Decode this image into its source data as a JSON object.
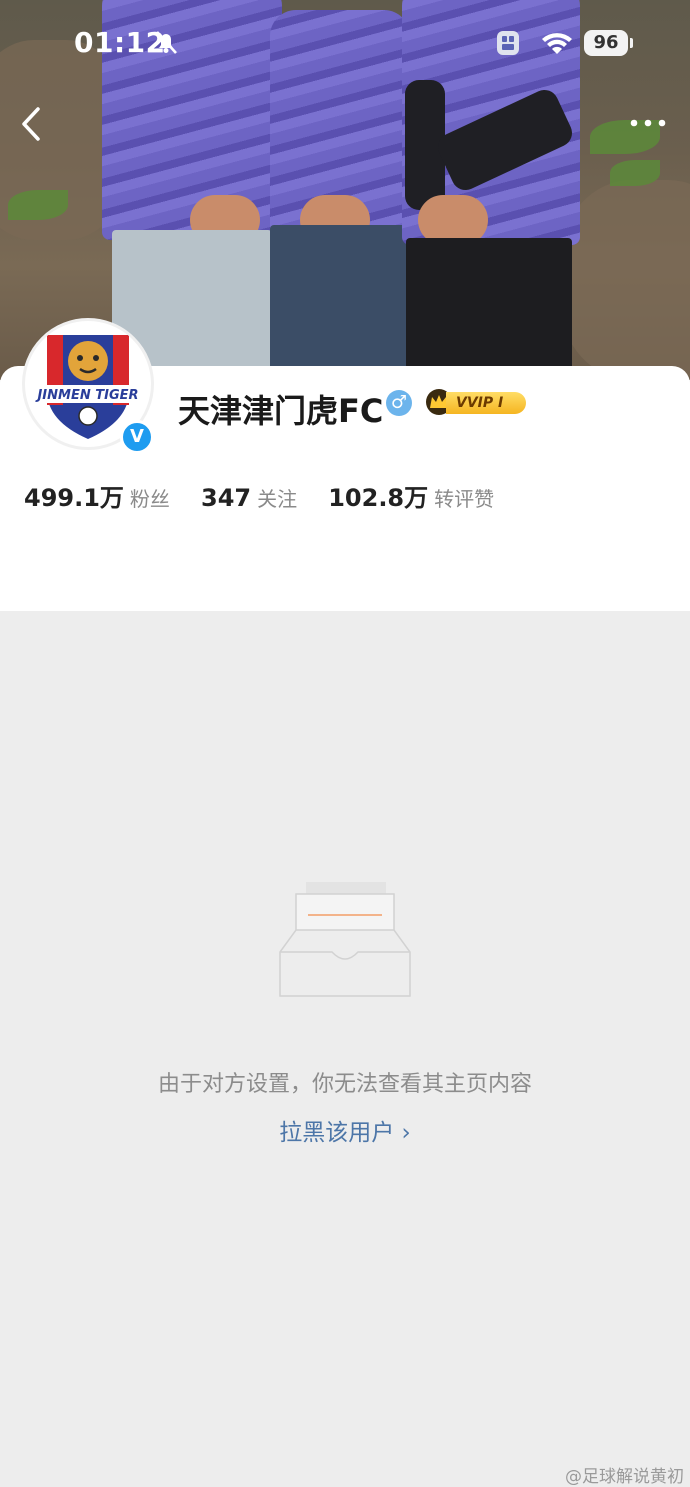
{
  "status_bar": {
    "time": "01:12",
    "battery": "96"
  },
  "profile": {
    "name": "天津津门虎FC",
    "gender_symbol": "♂",
    "verified_symbol": "V",
    "vip_label": "VVIP Ⅰ",
    "avatar_logo_text": "JINMEN TIGER",
    "stats": [
      {
        "value": "499.1万",
        "label": "粉丝"
      },
      {
        "value": "347",
        "label": "关注"
      },
      {
        "value": "102.8万",
        "label": "转评赞"
      }
    ]
  },
  "content": {
    "empty_message": "由于对方设置，你无法查看其主页内容",
    "block_link": "拉黑该用户 ›"
  },
  "watermark": "@足球解说黄初",
  "colors": {
    "verified_blue": "#1e9cf0",
    "link_blue": "#4d76a8",
    "vip_gold": "#f5b521",
    "page_gray": "#ededed"
  }
}
